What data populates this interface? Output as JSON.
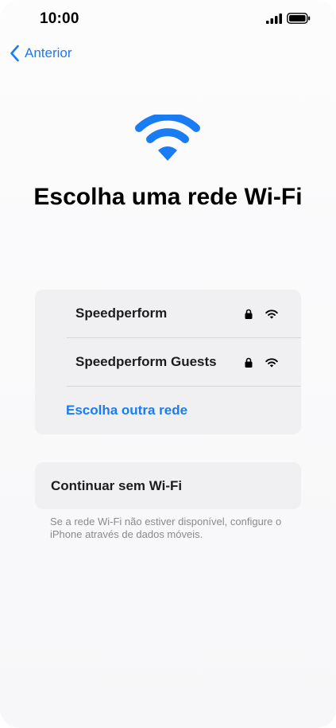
{
  "status_bar": {
    "time": "10:00",
    "icons": [
      "signal-bars-icon",
      "battery-icon"
    ]
  },
  "nav": {
    "back_label": "Anterior",
    "back_icon": "chevron-left-icon"
  },
  "hero": {
    "icon": "wifi-icon",
    "title": "Escolha uma rede Wi-Fi"
  },
  "networks": [
    {
      "name": "Speedperform",
      "secured": true,
      "icon": "wifi-icon"
    },
    {
      "name": "Speedperform Guests",
      "secured": true,
      "icon": "wifi-icon"
    }
  ],
  "other_network_label": "Escolha outra rede",
  "no_wifi": {
    "label": "Continuar sem Wi-Fi",
    "footnote": "Se a rede Wi-Fi não estiver disponível, configure o iPhone através de dados móveis."
  },
  "colors": {
    "accent": "#1a7cf2",
    "card": "#f0f0f3",
    "secondary_text": "#8a8a8e"
  }
}
